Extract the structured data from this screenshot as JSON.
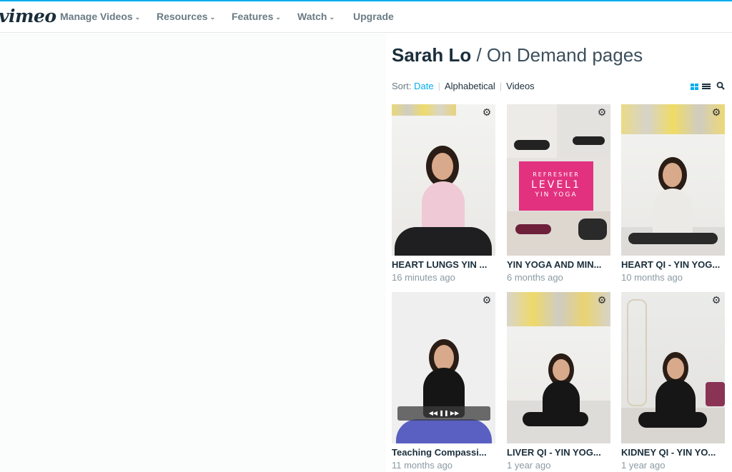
{
  "nav": {
    "logo": "vimeo",
    "items": [
      {
        "label": "Manage Videos",
        "has_dropdown": true
      },
      {
        "label": "Resources",
        "has_dropdown": true
      },
      {
        "label": "Features",
        "has_dropdown": true
      },
      {
        "label": "Watch",
        "has_dropdown": true
      },
      {
        "label": "Upgrade",
        "has_dropdown": false
      }
    ],
    "chevron": "⌄"
  },
  "header": {
    "owner": "Sarah Lo",
    "title_rest": " / On Demand pages"
  },
  "sort": {
    "label": "Sort:",
    "options": [
      {
        "label": "Date",
        "active": true
      },
      {
        "label": "Alphabetical",
        "active": false
      },
      {
        "label": "Videos",
        "active": false
      }
    ],
    "view_icons": [
      "grid-view-icon",
      "list-view-icon",
      "search-icon"
    ]
  },
  "cards": [
    {
      "title": "HEART LUNGS YIN ...",
      "subtitle": "16 minutes ago",
      "thumb": "woman-sitting-white-top"
    },
    {
      "title": "YIN YOGA AND MIN...",
      "subtitle": "6 months ago",
      "thumb": "refresher-level1-collage",
      "overlay_lines": [
        "REFRESHER",
        "LEVEL1",
        "YIN YOGA"
      ]
    },
    {
      "title": "HEART QI - YIN YOG...",
      "subtitle": "10 months ago",
      "thumb": "woman-meditating-white"
    },
    {
      "title": "Teaching Compassi...",
      "subtitle": "11 months ago",
      "thumb": "woman-black-top-player"
    },
    {
      "title": "LIVER QI - YIN YOG...",
      "subtitle": "1 year ago",
      "thumb": "woman-reclining-black"
    },
    {
      "title": "KIDNEY QI - YIN YO...",
      "subtitle": "1 year ago",
      "thumb": "woman-skeleton-studio"
    }
  ],
  "colors": {
    "accent": "#00adef",
    "text_dark": "#1a2e3b",
    "text_muted": "#8a9aa3",
    "pink": "#e2317f"
  }
}
